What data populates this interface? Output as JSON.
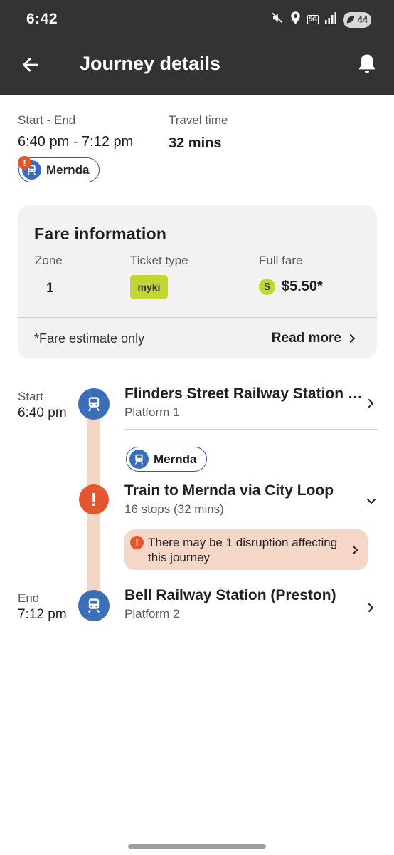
{
  "status_bar": {
    "time": "6:42",
    "network": "5G",
    "battery": "44"
  },
  "app_bar": {
    "title": "Journey details"
  },
  "summary": {
    "start_end_label": "Start - End",
    "start_end_value": "6:40 pm - 7:12 pm",
    "travel_time_label": "Travel time",
    "travel_time_value": "32 mins",
    "line_chip": "Mernda"
  },
  "fare": {
    "title": "Fare information",
    "zone_label": "Zone",
    "zone_value": "1",
    "ticket_label": "Ticket type",
    "ticket_value": "myki",
    "fare_label": "Full fare",
    "fare_currency_symbol": "$",
    "fare_value": "$5.50*",
    "note": "*Fare estimate only",
    "read_more": "Read more"
  },
  "timeline": {
    "start": {
      "label": "Start",
      "time": "6:40 pm",
      "station": "Flinders Street Railway Station (…",
      "platform": "Platform 1"
    },
    "leg": {
      "line_chip": "Mernda",
      "title": "Train to Mernda via City Loop",
      "detail": "16 stops (32 mins)",
      "disruption": "There may be 1 disruption affecting this journey"
    },
    "end": {
      "label": "End",
      "time": "7:12 pm",
      "station": "Bell Railway Station (Preston)",
      "platform": "Platform 2"
    }
  },
  "colors": {
    "header_bg": "#333333",
    "train_blue": "#3a6fb7",
    "alert_orange": "#e4572e",
    "myki_green": "#c1d72f",
    "route_line": "#f4d6c7",
    "disruption_bg": "#f6d7c7"
  }
}
